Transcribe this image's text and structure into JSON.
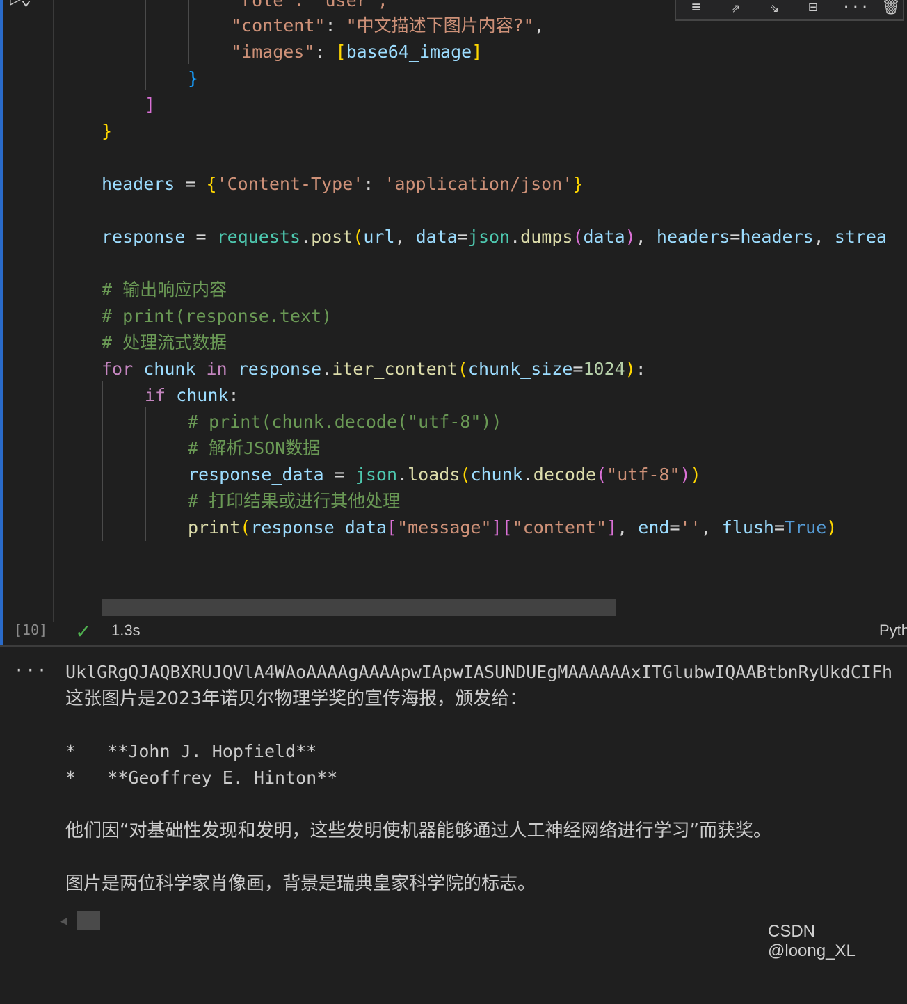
{
  "toolbar": {
    "icons": [
      "run-by-line-icon",
      "execute-above-icon",
      "execute-below-icon",
      "split-cell-icon",
      "more-icon",
      "delete-icon"
    ],
    "more_label": "···"
  },
  "code": {
    "line_role_partial": "\"role\": \"user\",",
    "line_content_key": "\"content\"",
    "line_content_val": "\"中文描述下图片内容?\"",
    "line_images_key": "\"images\"",
    "line_images_val": "base64_image",
    "close_brace_inner": "}",
    "close_bracket": "]",
    "close_brace_outer": "}",
    "headers_var": "headers",
    "headers_key": "'Content-Type'",
    "headers_val": "'application/json'",
    "resp_var": "response",
    "resp_mod": "requests",
    "resp_fn": "post",
    "resp_url": "url",
    "resp_data_kw": "data",
    "resp_json": "json",
    "resp_dumps": "dumps",
    "resp_data_arg": "data",
    "resp_headers_kw": "headers",
    "resp_headers_val": "headers",
    "resp_stream": "strea",
    "comment_1": "# 输出响应内容",
    "comment_2": "# print(response.text)",
    "comment_3": "# 处理流式数据",
    "for_kw": "for",
    "for_var": "chunk",
    "in_kw": "in",
    "for_resp": "response",
    "for_fn": "iter_content",
    "for_kw_arg": "chunk_size",
    "for_num": "1024",
    "if_kw": "if",
    "if_var": "chunk",
    "comment_4": "# print(chunk.decode(\"utf-8\"))",
    "comment_5": "# 解析JSON数据",
    "rd_var": "response_data",
    "rd_mod": "json",
    "rd_fn": "loads",
    "rd_chunk": "chunk",
    "rd_decode": "decode",
    "rd_str": "\"utf-8\"",
    "comment_6": "# 打印结果或进行其他处理",
    "print_fn": "print",
    "print_var": "response_data",
    "print_key1": "\"message\"",
    "print_key2": "\"content\"",
    "print_end": "end",
    "print_empty": "''",
    "print_flush": "flush",
    "print_true": "True"
  },
  "status": {
    "exec_count": "[10]",
    "duration": "1.3s",
    "language": "Pyth"
  },
  "output": {
    "more": "···",
    "line_base64": "UklGRgQJAQBXRUJQVlA4WAoAAAAgAAAApwIApwIASUNDUEgMAAAAAAxITGlubwIQAABtbnRyUkdCIFh",
    "line_desc": "这张图片是2023年诺贝尔物理学奖的宣传海报，颁发给：",
    "bullet_1": "*   **John J. Hopfield**",
    "bullet_2": "*   **Geoffrey E. Hinton**",
    "line_reason": "他们因“对基础性发现和发明，这些发明使机器能够通过人工神经网络进行学习”而获奖。",
    "line_bg": "图片是两位科学家肖像画，背景是瑞典皇家科学院的标志。"
  },
  "watermark": "CSDN @loong_XL"
}
